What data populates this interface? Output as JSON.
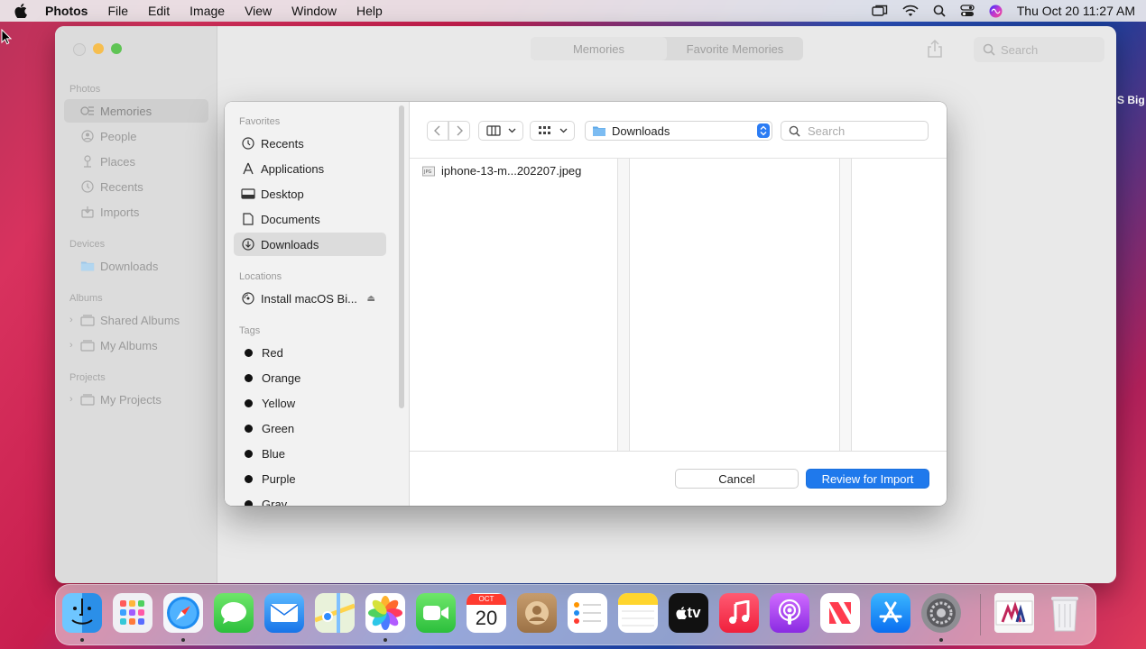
{
  "menubar": {
    "app_name": "Photos",
    "items": [
      "File",
      "Edit",
      "Image",
      "View",
      "Window",
      "Help"
    ],
    "clock": "Thu Oct 20  11:27 AM"
  },
  "photos_window": {
    "sidebar": {
      "photos_section": "Photos",
      "photos_items": [
        "Memories",
        "People",
        "Places",
        "Recents",
        "Imports"
      ],
      "devices_section": "Devices",
      "devices_items": [
        "Downloads"
      ],
      "albums_section": "Albums",
      "albums_items": [
        "Shared Albums",
        "My Albums"
      ],
      "projects_section": "Projects",
      "projects_items": [
        "My Projects"
      ]
    },
    "segments": [
      "Memories",
      "Favorite Memories"
    ],
    "search_placeholder": "Search"
  },
  "wallpaper_text": "S Big",
  "dialog": {
    "favorites_section": "Favorites",
    "favorites": [
      "Recents",
      "Applications",
      "Desktop",
      "Documents",
      "Downloads"
    ],
    "locations_section": "Locations",
    "locations": [
      "Install macOS Bi..."
    ],
    "tags_section": "Tags",
    "tags": [
      {
        "label": "Red"
      },
      {
        "label": "Orange"
      },
      {
        "label": "Yellow"
      },
      {
        "label": "Green"
      },
      {
        "label": "Blue"
      },
      {
        "label": "Purple"
      },
      {
        "label": "Gray"
      }
    ],
    "current_folder": "Downloads",
    "search_placeholder": "Search",
    "files": [
      "iphone-13-m...202207.jpeg"
    ],
    "cancel_label": "Cancel",
    "import_label": "Review for Import"
  },
  "dock": {
    "calendar_month": "OCT",
    "calendar_day": "20",
    "tv_label": "tv",
    "apps": [
      "finder",
      "launchpad",
      "safari",
      "messages",
      "mail",
      "maps",
      "photos",
      "facetime",
      "calendar",
      "contacts",
      "reminders",
      "notes",
      "apple-tv",
      "music",
      "podcasts",
      "news",
      "app-store",
      "system-preferences",
      "preview",
      "trash"
    ],
    "colors": {
      "accent": "#1f79ec"
    }
  }
}
